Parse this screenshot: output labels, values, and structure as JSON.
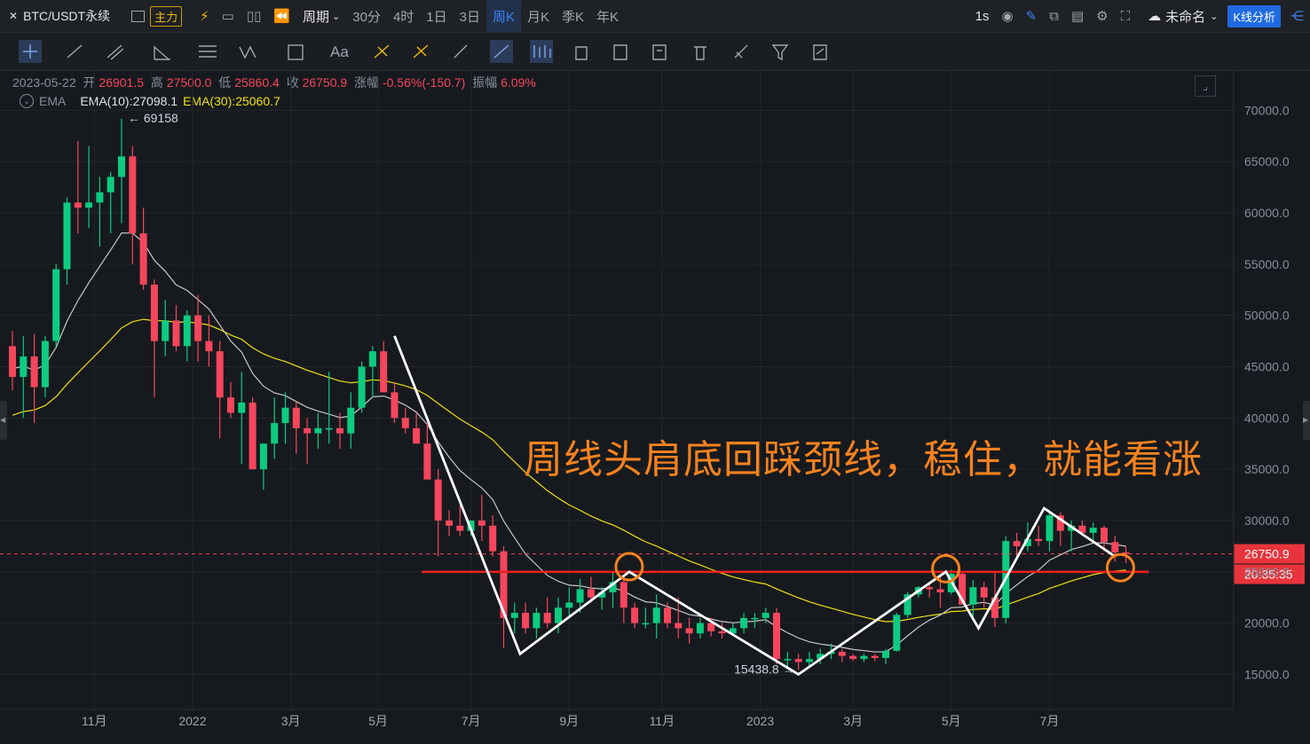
{
  "topbar": {
    "symbol": "BTC/USDT永续",
    "main_badge": "主力",
    "period_label": "周期",
    "intervals": [
      "30分",
      "4时",
      "1日",
      "3日",
      "周K",
      "月K",
      "季K",
      "年K"
    ],
    "active_interval": "周K",
    "speed": "1s",
    "layout_name": "未命名",
    "kline_analysis": "K线分析"
  },
  "info": {
    "date": "2023-05-22",
    "open_label": "开",
    "open": "26901.5",
    "high_label": "高",
    "high": "27500.0",
    "low_label": "低",
    "low": "25860.4",
    "close_label": "收",
    "close": "26750.9",
    "change_label": "涨幅",
    "change": "-0.56%(-150.7)",
    "amp_label": "振幅",
    "amp": "6.09%",
    "ema_name": "EMA",
    "ema10": "EMA(10):27098.1",
    "ema30": "EMA(30):25060.7"
  },
  "annotation": "周线头肩底回踩颈线，稳住，就能看涨",
  "colors": {
    "up": "#0ecb81",
    "down": "#f6465d",
    "ema10": "#c8c8c8",
    "ema30": "#f0e010",
    "annot": "#f5821f",
    "neckline": "#f0201e"
  },
  "chart_data": {
    "type": "candlestick",
    "title": "BTC/USDT永续 周K",
    "y_ticks": [
      15000,
      20000,
      25000,
      30000,
      35000,
      40000,
      45000,
      50000,
      55000,
      60000,
      65000,
      70000
    ],
    "y_tick_labels": [
      "15000.0",
      "20000.0",
      "25000.0",
      "30000.0",
      "35000.0",
      "40000.0",
      "45000.0",
      "50000.0",
      "55000.0",
      "60000.0",
      "65000.0",
      "70000.0"
    ],
    "ylim": [
      12200,
      73000
    ],
    "x_labels": [
      "11月",
      "2022",
      "3月",
      "5月",
      "7月",
      "9月",
      "11月",
      "2023",
      "3月",
      "5月",
      "7月"
    ],
    "x_label_index": [
      7.5,
      16.5,
      25.5,
      33.5,
      42,
      51,
      59.5,
      68.5,
      77,
      86,
      95
    ],
    "candles": [
      [
        47000,
        48500,
        42700,
        44000
      ],
      [
        44000,
        48000,
        40000,
        46000
      ],
      [
        46000,
        48200,
        39500,
        43000
      ],
      [
        43000,
        48000,
        42000,
        47500
      ],
      [
        47500,
        55000,
        47000,
        54500
      ],
      [
        54500,
        61500,
        53000,
        61000
      ],
      [
        61000,
        67000,
        58000,
        60500
      ],
      [
        60500,
        66500,
        58500,
        61000
      ],
      [
        61000,
        63500,
        56700,
        62000
      ],
      [
        62000,
        64000,
        58000,
        63500
      ],
      [
        63500,
        69158,
        59000,
        65500
      ],
      [
        65500,
        66500,
        55000,
        58000
      ],
      [
        58000,
        60500,
        52500,
        53000
      ],
      [
        53000,
        53500,
        42000,
        47500
      ],
      [
        47500,
        51500,
        46000,
        49500
      ],
      [
        49500,
        51000,
        46500,
        47000
      ],
      [
        47000,
        50500,
        45500,
        50000
      ],
      [
        50000,
        52000,
        45500,
        47500
      ],
      [
        47500,
        50000,
        45000,
        46500
      ],
      [
        46500,
        47500,
        38000,
        42000
      ],
      [
        42000,
        43500,
        40000,
        40500
      ],
      [
        40500,
        44500,
        35500,
        41500
      ],
      [
        41500,
        42000,
        35000,
        35000
      ],
      [
        35000,
        37500,
        33000,
        37500
      ],
      [
        37500,
        42000,
        36000,
        39500
      ],
      [
        39500,
        42500,
        37500,
        41000
      ],
      [
        41000,
        41500,
        36500,
        39000
      ],
      [
        39000,
        40000,
        35500,
        38500
      ],
      [
        38500,
        40500,
        37000,
        39000
      ],
      [
        39000,
        44500,
        37500,
        39000
      ],
      [
        39000,
        40500,
        37000,
        38500
      ],
      [
        38500,
        42500,
        37000,
        41000
      ],
      [
        41000,
        45500,
        40500,
        45000
      ],
      [
        45000,
        47000,
        42000,
        46500
      ],
      [
        46500,
        47500,
        43000,
        42500
      ],
      [
        42500,
        43500,
        39500,
        40000
      ],
      [
        40000,
        41000,
        38500,
        39000
      ],
      [
        39000,
        40500,
        37500,
        37500
      ],
      [
        37500,
        39500,
        34500,
        34000
      ],
      [
        34000,
        35000,
        26500,
        30000
      ],
      [
        30000,
        31000,
        28500,
        29500
      ],
      [
        29500,
        31500,
        28500,
        29000
      ],
      [
        29000,
        30000,
        28500,
        30000
      ],
      [
        30000,
        32500,
        28000,
        29500
      ],
      [
        29500,
        30500,
        26500,
        27000
      ],
      [
        27000,
        27500,
        17600,
        20500
      ],
      [
        20500,
        22000,
        19000,
        21000
      ],
      [
        21000,
        22000,
        19000,
        19500
      ],
      [
        19500,
        21500,
        18500,
        21000
      ],
      [
        21000,
        22500,
        19500,
        20000
      ],
      [
        20000,
        22500,
        19000,
        21500
      ],
      [
        21500,
        23500,
        20500,
        22000
      ],
      [
        22000,
        24300,
        21000,
        23300
      ],
      [
        23300,
        24500,
        22000,
        22500
      ],
      [
        22500,
        23500,
        21300,
        23000
      ],
      [
        23000,
        25000,
        21500,
        24000
      ],
      [
        24000,
        24500,
        20000,
        21500
      ],
      [
        21500,
        22000,
        19500,
        20000
      ],
      [
        20000,
        21500,
        19500,
        20000
      ],
      [
        20000,
        22800,
        18500,
        21500
      ],
      [
        21500,
        22000,
        19500,
        20000
      ],
      [
        20000,
        22500,
        18500,
        19500
      ],
      [
        19500,
        20500,
        18000,
        19000
      ],
      [
        19000,
        20500,
        18500,
        20000
      ],
      [
        20000,
        20500,
        18700,
        19200
      ],
      [
        19200,
        20000,
        18500,
        19000
      ],
      [
        19000,
        20000,
        18800,
        19500
      ],
      [
        19500,
        21000,
        19000,
        20500
      ],
      [
        20500,
        21000,
        19500,
        20500
      ],
      [
        20500,
        21500,
        20000,
        21000
      ],
      [
        21000,
        21500,
        16000,
        16500
      ],
      [
        16500,
        17200,
        15500,
        16500
      ],
      [
        16500,
        17000,
        15438,
        16200
      ],
      [
        16200,
        17200,
        15800,
        16500
      ],
      [
        16500,
        17500,
        16000,
        17000
      ],
      [
        17000,
        18000,
        16500,
        17200
      ],
      [
        17200,
        17500,
        16200,
        16800
      ],
      [
        16800,
        17000,
        16300,
        16500
      ],
      [
        16500,
        17000,
        16200,
        16800
      ],
      [
        16800,
        17000,
        16300,
        16600
      ],
      [
        16600,
        17500,
        16000,
        17300
      ],
      [
        17300,
        21000,
        17200,
        20800
      ],
      [
        20800,
        23000,
        20500,
        22800
      ],
      [
        22800,
        23600,
        22500,
        23500
      ],
      [
        23500,
        24000,
        22500,
        23300
      ],
      [
        23300,
        24500,
        21500,
        23000
      ],
      [
        23000,
        25200,
        22800,
        24800
      ],
      [
        24800,
        25000,
        22000,
        21800
      ],
      [
        21800,
        24200,
        20500,
        23500
      ],
      [
        23500,
        24000,
        21500,
        22500
      ],
      [
        22500,
        25000,
        19600,
        20500
      ],
      [
        20500,
        28500,
        20000,
        28000
      ],
      [
        28000,
        28800,
        26500,
        27500
      ],
      [
        27500,
        29800,
        27000,
        28200
      ],
      [
        28200,
        29500,
        27500,
        28000
      ],
      [
        28000,
        31000,
        27000,
        30500
      ],
      [
        30500,
        30800,
        27500,
        29000
      ],
      [
        29000,
        30000,
        27000,
        29500
      ],
      [
        29500,
        30000,
        28500,
        28800
      ],
      [
        28800,
        29800,
        28000,
        29300
      ],
      [
        29300,
        29500,
        27000,
        27900
      ],
      [
        27900,
        28500,
        26000,
        26900
      ],
      [
        26900,
        27500,
        25860,
        26751
      ]
    ],
    "series": [
      {
        "name": "EMA(10)",
        "last": 27098.1
      },
      {
        "name": "EMA(30)",
        "last": 25060.7
      }
    ],
    "annotations": {
      "high_label": "69158",
      "low_label": "15438.8",
      "last_price": "26750.9",
      "countdown": "20:35:35",
      "neckline_value": 25000,
      "pattern_points": [
        [
          35,
          48000
        ],
        [
          46.5,
          17000
        ],
        [
          56.5,
          25000
        ],
        [
          72,
          15000
        ],
        [
          85.5,
          25000
        ],
        [
          88.5,
          19500
        ],
        [
          94.5,
          31200
        ],
        [
          101,
          26500
        ]
      ],
      "circles": [
        [
          56.5,
          25500
        ],
        [
          85.5,
          25300
        ],
        [
          101.5,
          25400
        ]
      ]
    }
  }
}
